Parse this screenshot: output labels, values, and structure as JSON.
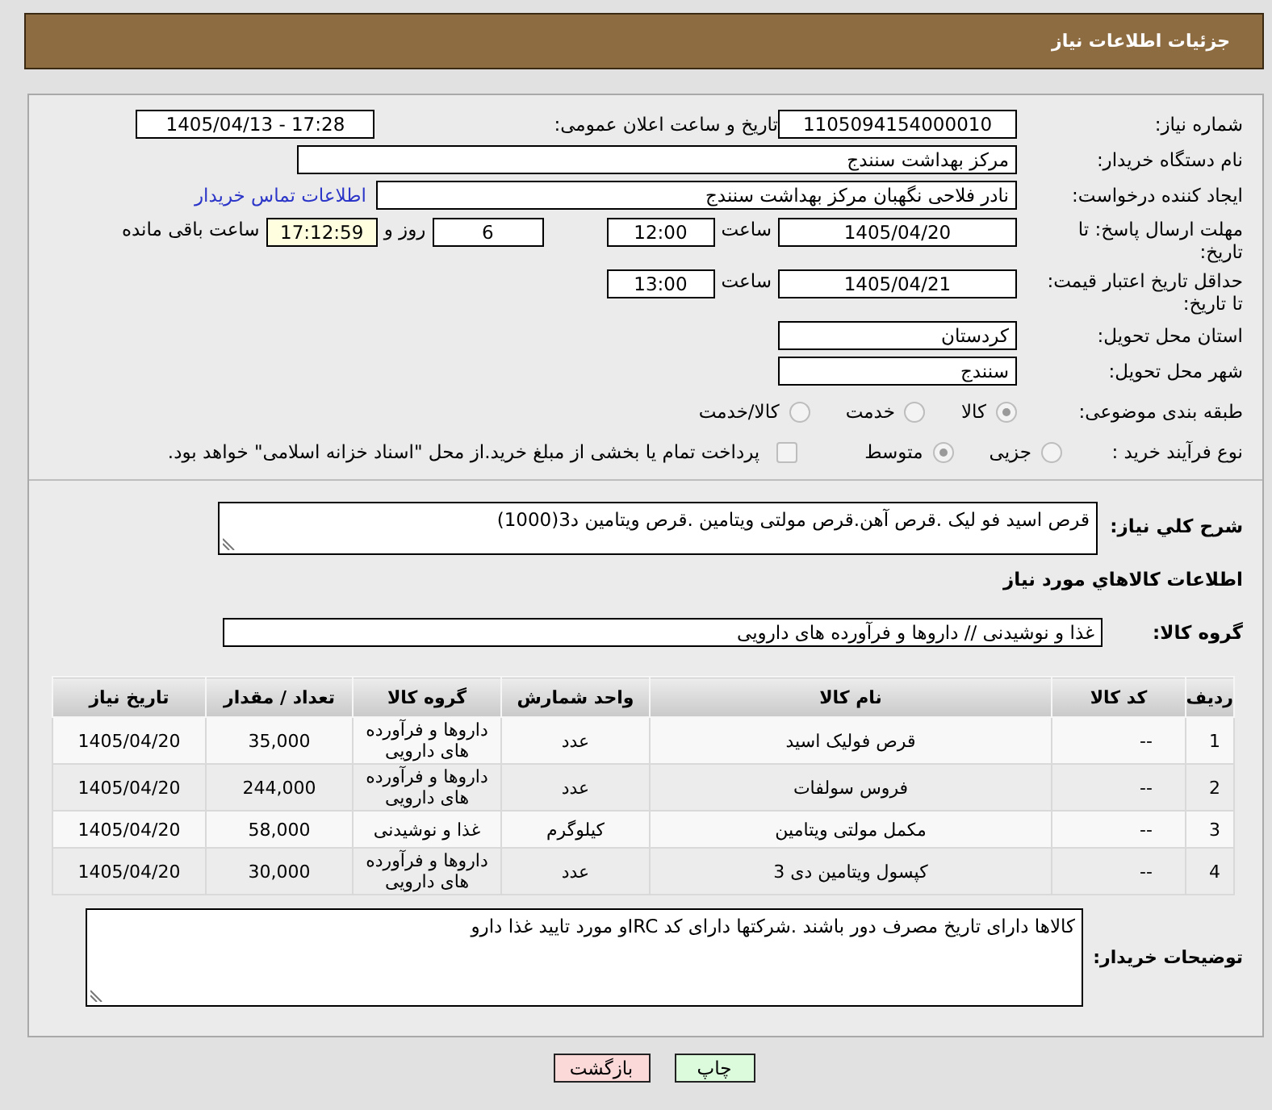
{
  "header": {
    "title": "جزئیات اطلاعات نیاز"
  },
  "need_number": {
    "label": "شماره نیاز:",
    "value": "1105094154000010"
  },
  "announce_datetime": {
    "label": "تاریخ و ساعت اعلان عمومی:",
    "value": "1405/04/13 - 17:28"
  },
  "buyer_org": {
    "label": "نام دستگاه خریدار:",
    "value": "مرکز بهداشت سنندج"
  },
  "requester": {
    "label": "ایجاد کننده درخواست:",
    "value": "نادر فلاحی نگهبان مرکز بهداشت سنندج",
    "link": "اطلاعات تماس خریدار"
  },
  "response_deadline": {
    "label": "مهلت ارسال پاسخ: تا تاریخ:",
    "date": "1405/04/20",
    "time_label": "ساعت",
    "time": "12:00",
    "days": "6",
    "days_label": "روز و",
    "remaining": "17:12:59",
    "remaining_label": "ساعت باقی مانده"
  },
  "price_validity": {
    "label": "حداقل تاریخ اعتبار قیمت: تا تاریخ:",
    "date": "1405/04/21",
    "time_label": "ساعت",
    "time": "13:00"
  },
  "delivery_province": {
    "label": "استان محل تحویل:",
    "value": "کردستان"
  },
  "delivery_city": {
    "label": "شهر محل تحویل:",
    "value": "سنندج"
  },
  "subject_category": {
    "label": "طبقه بندی موضوعی:",
    "options": [
      {
        "label": "کالا",
        "selected": true
      },
      {
        "label": "خدمت",
        "selected": false
      },
      {
        "label": "کالا/خدمت",
        "selected": false
      }
    ]
  },
  "purchase_process": {
    "label": "نوع فرآیند خرید :",
    "options": [
      {
        "label": "جزیی",
        "selected": false
      },
      {
        "label": "متوسط",
        "selected": true
      }
    ],
    "treasury_option": {
      "label": "پرداخت تمام یا بخشی از مبلغ خرید.از محل \"اسناد خزانه اسلامی\" خواهد بود.",
      "checked": false
    }
  },
  "description": {
    "label": "شرح کلي نیاز:",
    "value": "قرص اسید فو لیک .قرص آهن.قرص مولتی ویتامین .قرص ویتامین د3(1000)"
  },
  "goods_section": {
    "title": "اطلاعات کالاهاي مورد نياز"
  },
  "goods_group": {
    "label": "گروه کالا:",
    "value": "غذا و نوشیدنی // داروها و فرآورده های دارویی"
  },
  "table": {
    "columns": [
      "ردیف",
      "کد کالا",
      "نام کالا",
      "واحد شمارش",
      "گروه کالا",
      "تعداد / مقدار",
      "تاریخ نیاز"
    ],
    "rows": [
      [
        "1",
        "--",
        "قرص فولیک اسید",
        "عدد",
        "داروها و فرآورده های دارویی",
        "35,000",
        "1405/04/20"
      ],
      [
        "2",
        "--",
        "فروس سولفات",
        "عدد",
        "داروها و فرآورده های دارویی",
        "244,000",
        "1405/04/20"
      ],
      [
        "3",
        "--",
        "مکمل مولتی ویتامین",
        "کیلوگرم",
        "غذا و نوشیدنی",
        "58,000",
        "1405/04/20"
      ],
      [
        "4",
        "--",
        "کپسول ویتامین دی 3",
        "عدد",
        "داروها و فرآورده های دارویی",
        "30,000",
        "1405/04/20"
      ]
    ]
  },
  "buyer_notes": {
    "label": "توضیحات خریدار:",
    "value": "کالاها دارای تاریخ مصرف دور باشند .شرکتها دارای کد IRCو مورد تایید غذا دارو"
  },
  "buttons": [
    {
      "label": "چاپ",
      "kind": "print"
    },
    {
      "label": "بازگشت",
      "kind": "back"
    }
  ]
}
